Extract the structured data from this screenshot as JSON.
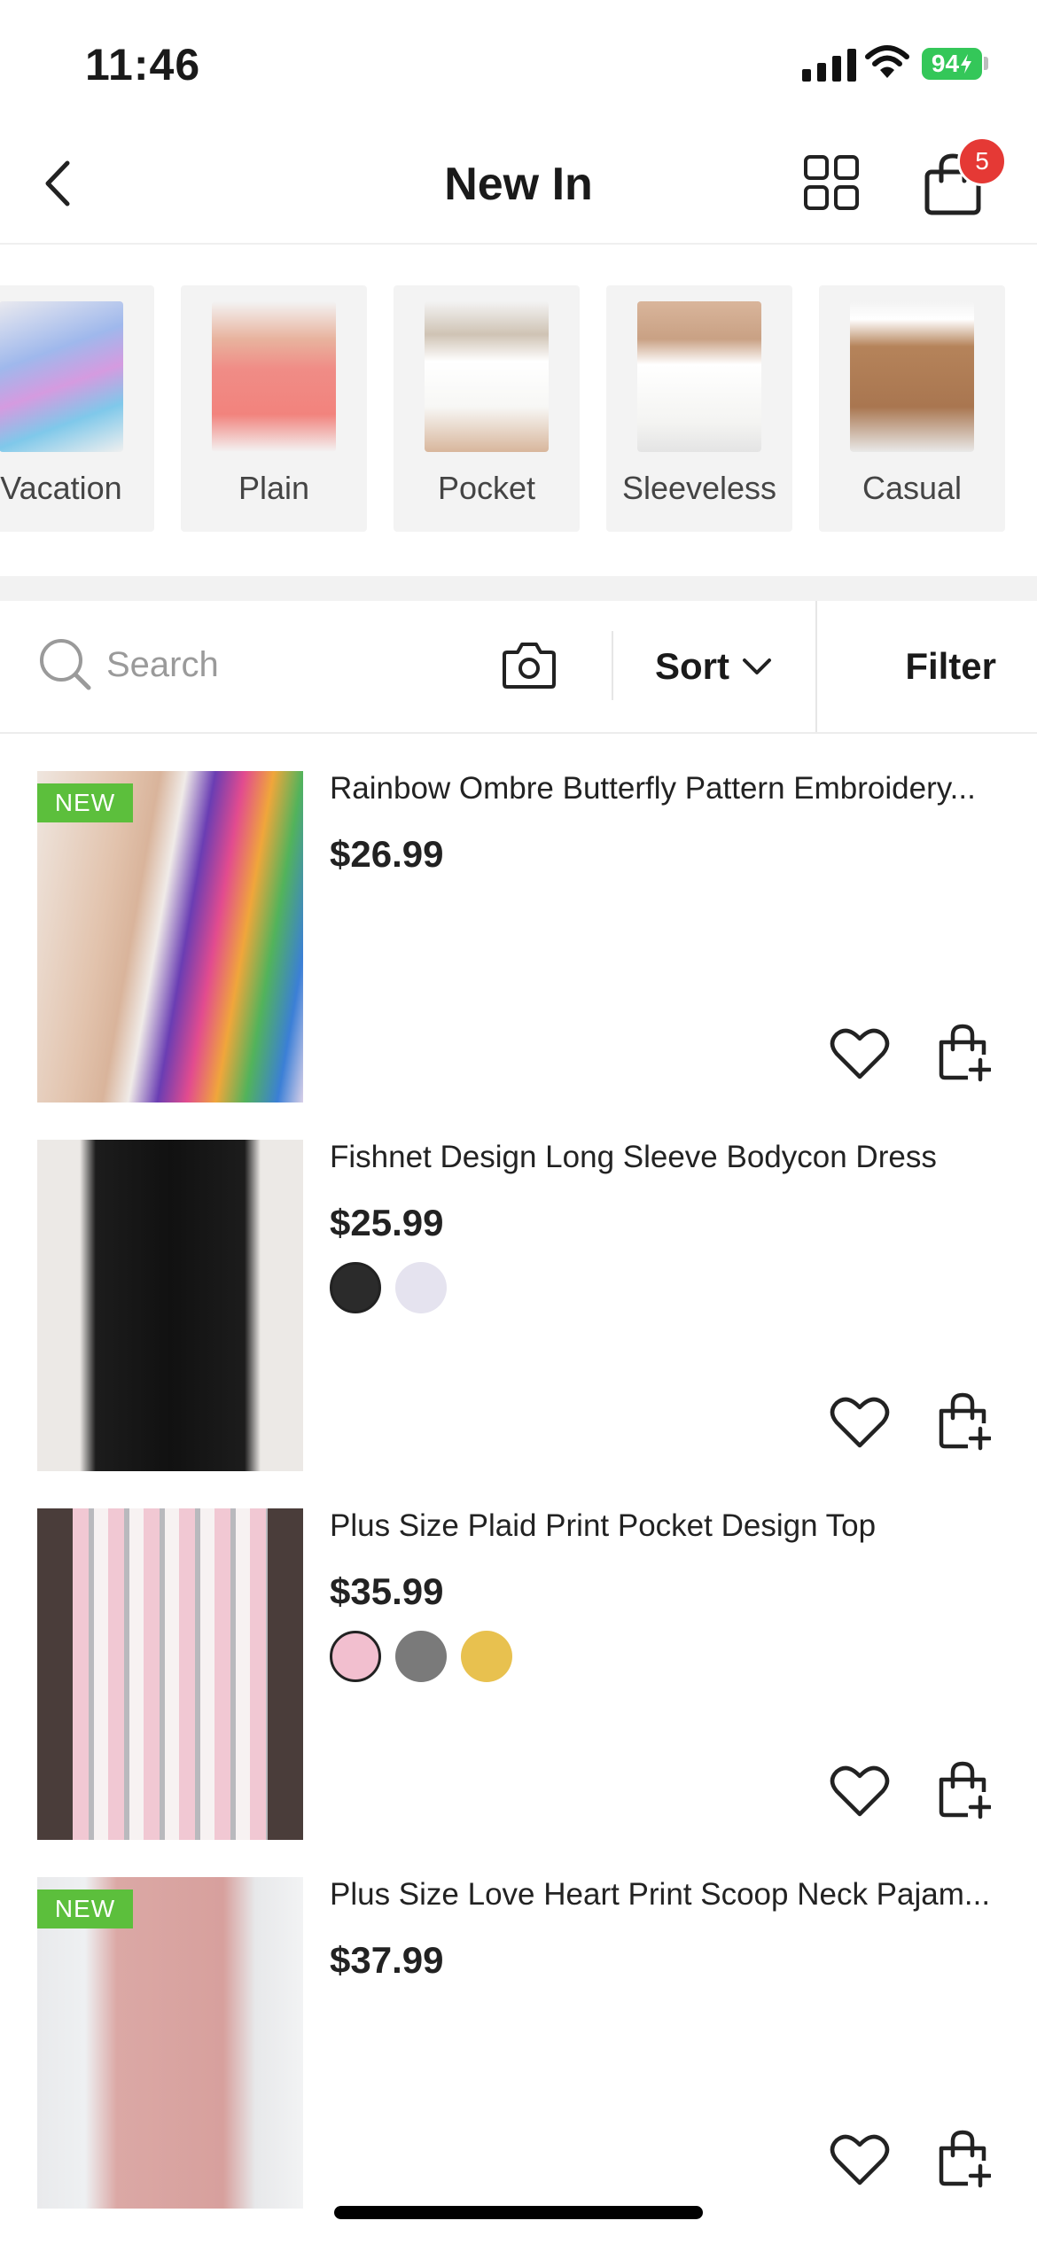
{
  "status_bar": {
    "time": "11:46",
    "battery": "94"
  },
  "nav": {
    "title": "New In",
    "cart_count": "5"
  },
  "categories": [
    {
      "label": "Vacation"
    },
    {
      "label": "Plain"
    },
    {
      "label": "Pocket"
    },
    {
      "label": "Sleeveless"
    },
    {
      "label": "Casual"
    }
  ],
  "toolbar": {
    "search_placeholder": "Search",
    "sort_label": "Sort",
    "filter_label": "Filter"
  },
  "products": [
    {
      "title": "Rainbow Ombre Butterfly Pattern Embroidery...",
      "price": "$26.99",
      "tag": "NEW",
      "swatches": []
    },
    {
      "title": "Fishnet Design Long Sleeve Bodycon Dress",
      "price": "$25.99",
      "tag": "",
      "swatches": [
        "#2b2b2b",
        "#e5e3ef"
      ]
    },
    {
      "title": "Plus Size Plaid Print Pocket Design Top",
      "price": "$35.99",
      "tag": "",
      "swatches": [
        "#f2bfcf",
        "#7a7a7a",
        "#e8c14f"
      ]
    },
    {
      "title": "Plus Size Love Heart Print Scoop Neck Pajam...",
      "price": "$37.99",
      "tag": "NEW",
      "swatches": []
    }
  ],
  "colors": {
    "badge": "#e53935",
    "new_tag": "#5cbf3c",
    "battery": "#34c759"
  }
}
